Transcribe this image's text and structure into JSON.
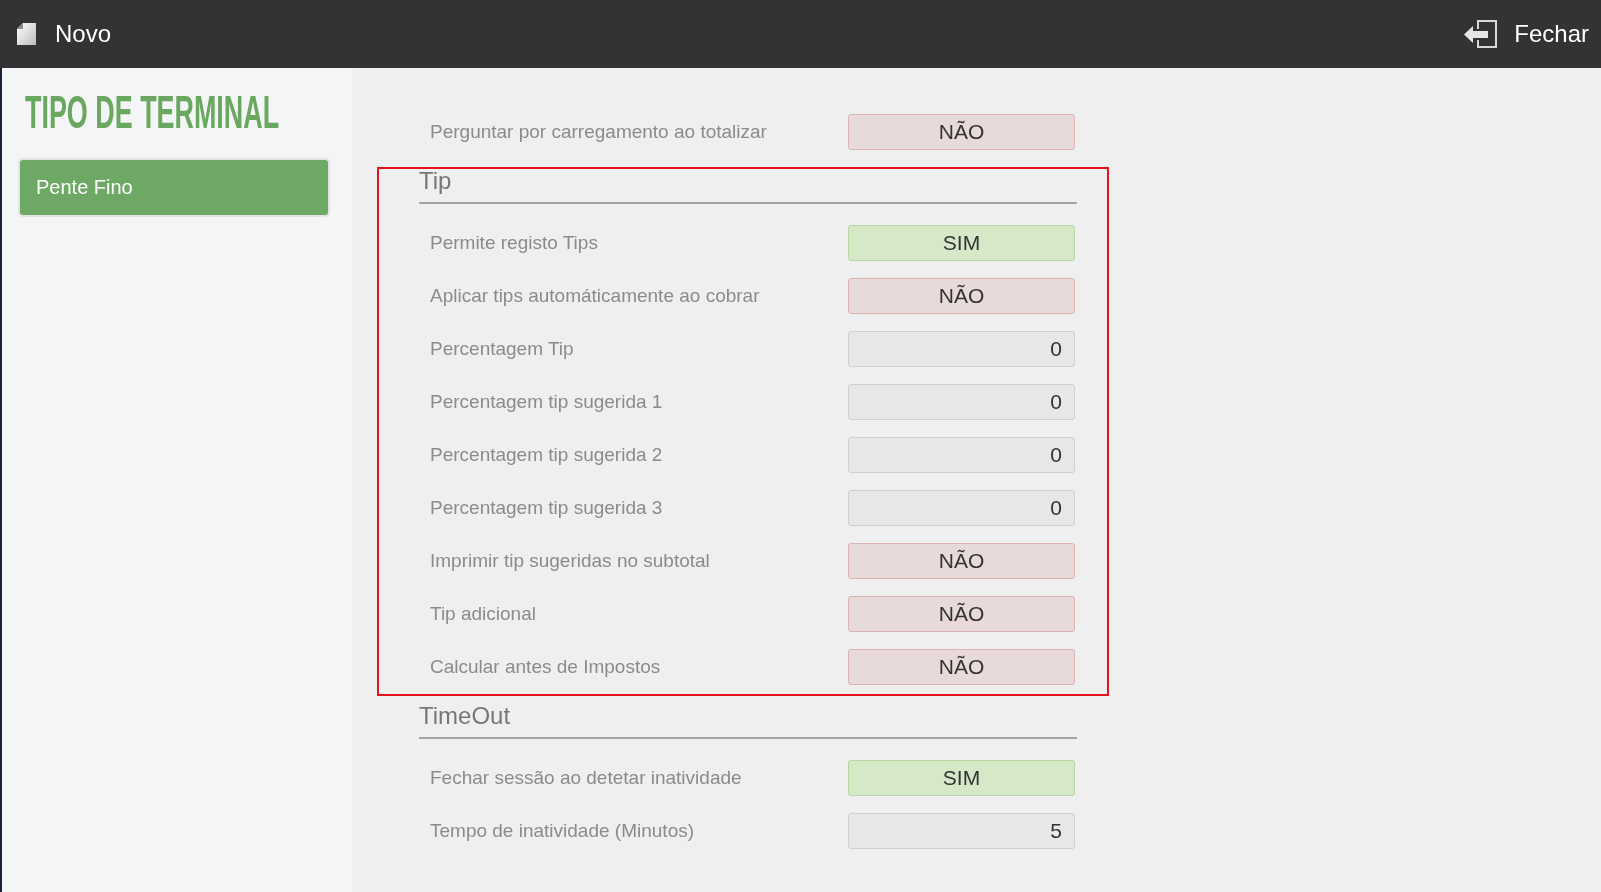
{
  "header": {
    "title": "Novo",
    "close_label": "Fechar"
  },
  "sidebar": {
    "heading": "TIPO DE TERMINAL",
    "items": [
      {
        "label": "Pente Fino",
        "selected": true
      }
    ]
  },
  "sections": [
    {
      "highlighted": false,
      "rows": [
        {
          "kind": "toggle",
          "label": "Perguntar por carregamento ao totalizar",
          "value": "NÃO",
          "on": false
        }
      ]
    },
    {
      "title": "Tip",
      "highlighted": true,
      "rows": [
        {
          "kind": "toggle",
          "label": "Permite registo Tips",
          "value": "SIM",
          "on": true
        },
        {
          "kind": "toggle",
          "label": "Aplicar tips automáticamente ao cobrar",
          "value": "NÃO",
          "on": false
        },
        {
          "kind": "number",
          "label": "Percentagem Tip",
          "value": "0"
        },
        {
          "kind": "number",
          "label": "Percentagem tip sugerida 1",
          "value": "0"
        },
        {
          "kind": "number",
          "label": "Percentagem tip sugerida 2",
          "value": "0"
        },
        {
          "kind": "number",
          "label": "Percentagem tip sugerida 3",
          "value": "0"
        },
        {
          "kind": "toggle",
          "label": "Imprimir tip sugeridas no subtotal",
          "value": "NÃO",
          "on": false
        },
        {
          "kind": "toggle",
          "label": "Tip adicional",
          "value": "NÃO",
          "on": false
        },
        {
          "kind": "toggle",
          "label": "Calcular antes de Impostos",
          "value": "NÃO",
          "on": false
        }
      ]
    },
    {
      "title": "TimeOut",
      "highlighted": false,
      "rows": [
        {
          "kind": "toggle",
          "label": "Fechar sessão ao detetar inatividade",
          "value": "SIM",
          "on": true
        },
        {
          "kind": "number",
          "label": "Tempo de inatividade (Minutos)",
          "value": "5"
        }
      ]
    }
  ]
}
